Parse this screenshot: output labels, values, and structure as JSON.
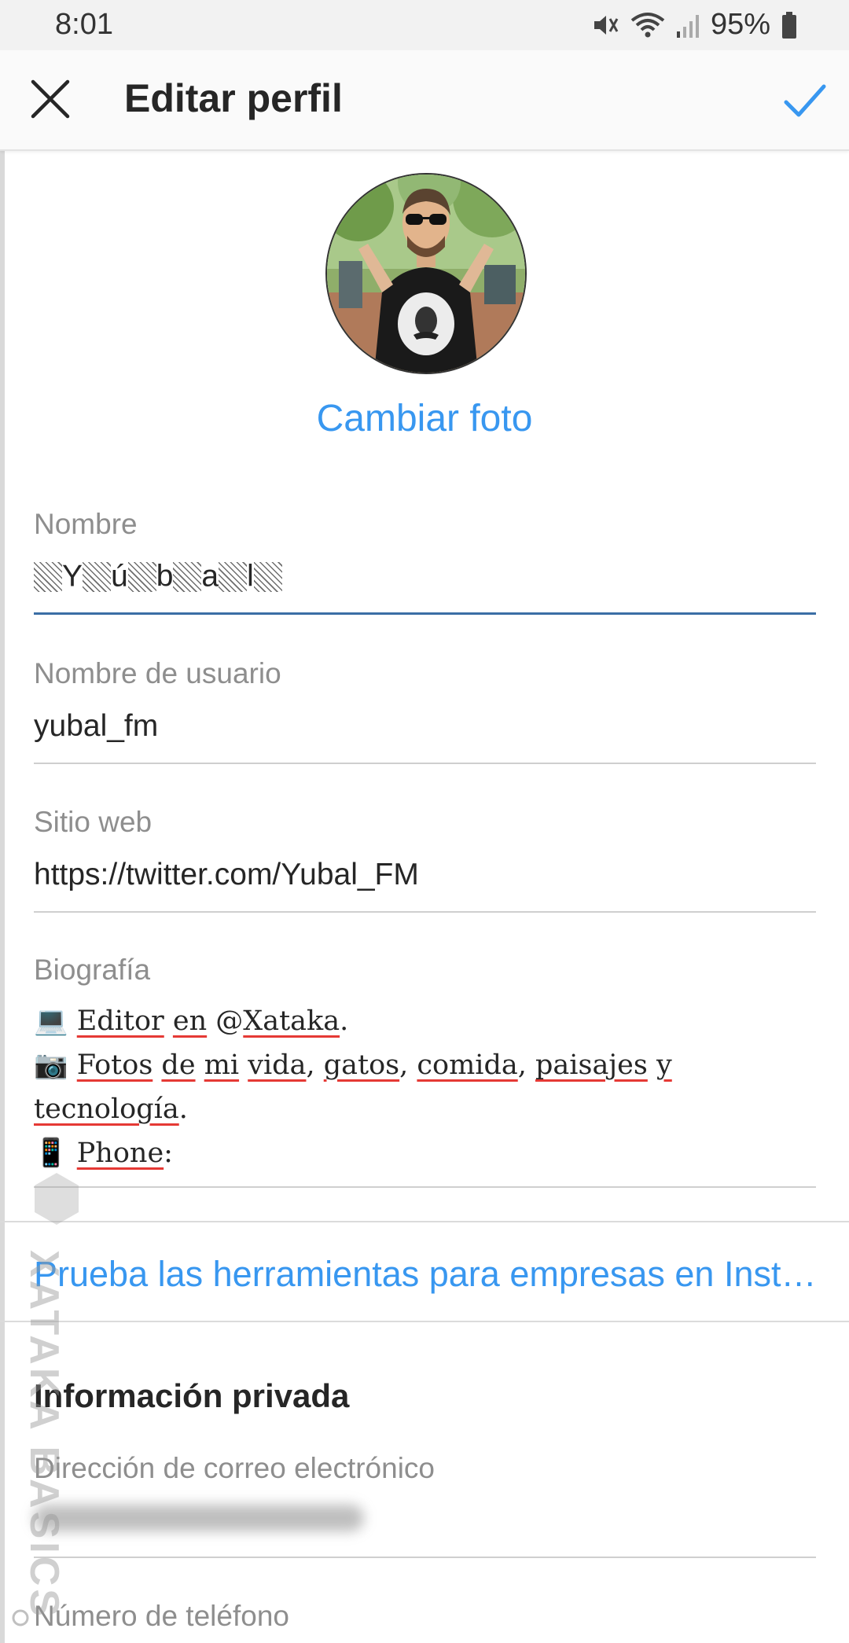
{
  "status_bar": {
    "time": "8:01",
    "battery": "95%"
  },
  "app_bar": {
    "title": "Editar perfil"
  },
  "profile": {
    "change_photo": "Cambiar foto"
  },
  "fields": {
    "name": {
      "label": "Nombre",
      "chars": [
        "Y",
        "ú",
        "b",
        "a",
        "l"
      ]
    },
    "username": {
      "label": "Nombre de usuario",
      "value": "yubal_fm"
    },
    "website": {
      "label": "Sitio web",
      "value": "https://twitter.com/Yubal_FM"
    },
    "bio": {
      "label": "Biografía",
      "line1": {
        "emoji": "💻",
        "w1": "Editor",
        "w2": "en",
        "at": "@",
        "w3": "Xataka",
        "end": "."
      },
      "line2": {
        "emoji": "📷",
        "w1": "Fotos",
        "w2": "de",
        "w3": "mi",
        "w4": "vida",
        "w5": "gatos",
        "w6": "comida",
        "w7": "paisajes",
        "w8": "y",
        "w9": "tecnología",
        "end": ".",
        "comma": ","
      },
      "line3": {
        "emoji": "📱",
        "w1": "Phone",
        "end": ":"
      }
    }
  },
  "business_tools_link": "Prueba las herramientas para empresas en Inst…",
  "private_info": {
    "title": "Información privada",
    "email_label": "Dirección de correo electrónico",
    "phone_label": "Número de teléfono"
  },
  "watermark": "XATAKA BASICS",
  "colors": {
    "accent": "#3897f0",
    "active_underline": "#3b6ea5",
    "spellcheck": "#e53935"
  }
}
